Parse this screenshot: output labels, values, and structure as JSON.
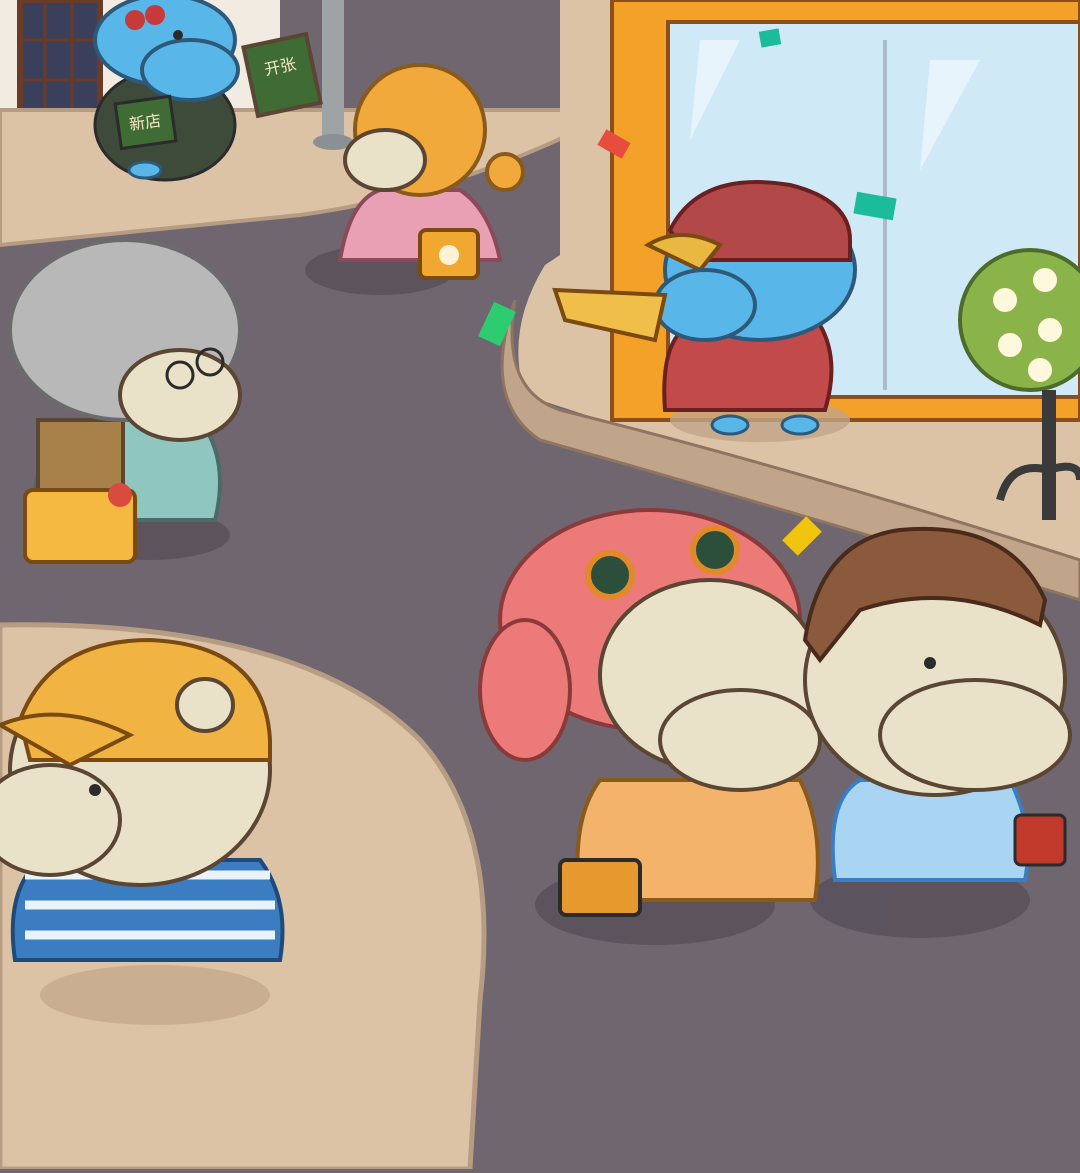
{
  "scene": {
    "title": "",
    "palette": {
      "road": "#6f6670",
      "sidewalk": "#dcc3a6",
      "sidewalk_edge": "#b79c84",
      "shop_frame": "#f3a129",
      "glass": "#cfe9f6",
      "hippo_skin": "#e9e2c9",
      "outline": "#5b4533"
    },
    "signs": {
      "shop_board": "新店",
      "shop_board_alt": "开张",
      "apron_text": "新店"
    },
    "characters": [
      {
        "id": "blue-hippo-shopkeeper",
        "icon": "hippo-blue-apron",
        "color": "#58b6e8"
      },
      {
        "id": "blonde-girl",
        "icon": "hippo-pink-dress",
        "color": "#f2a93b"
      },
      {
        "id": "granny",
        "icon": "hippo-grey-hair",
        "color": "#b8b8b8"
      },
      {
        "id": "megaphone-hippo",
        "icon": "hippo-red-cap",
        "color": "#c24a4a"
      },
      {
        "id": "yellow-cap-hippo",
        "icon": "hippo-yellow-cap",
        "color": "#f1b342"
      },
      {
        "id": "pink-hair-hippo",
        "icon": "hippo-pink-hair",
        "color": "#ec7a78"
      },
      {
        "id": "brown-hair-hippo",
        "icon": "hippo-brown-hair",
        "color": "#8b5a3c"
      }
    ],
    "confetti_colors": [
      "#e74c3c",
      "#2ecc71",
      "#f1c40f",
      "#1abc9c"
    ]
  }
}
